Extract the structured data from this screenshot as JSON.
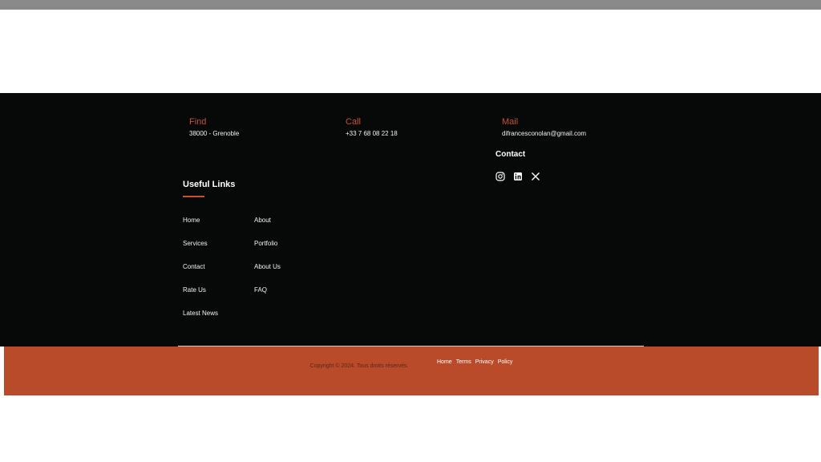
{
  "footer": {
    "find": {
      "title": "Find",
      "text": "38000 - Grenoble"
    },
    "call": {
      "title": "Call",
      "text": "+33 7 68 08 22 18"
    },
    "mail": {
      "title": "Mail",
      "text": "difrancesconolan@gmail.com"
    },
    "contact_heading": "Contact",
    "social": [
      "instagram-icon",
      "linkedin-icon",
      "x-icon"
    ],
    "useful_links_heading": "Useful Links",
    "links_left": [
      "Home",
      "Services",
      "Contact",
      "Rate Us",
      "Latest News"
    ],
    "links_right": [
      "About",
      "Portfolio",
      "About Us",
      "FAQ"
    ]
  },
  "bottom": {
    "copyright": "Copyright © 2024. Tous droits réservés.",
    "policy_links": [
      "Home",
      "Terms",
      "Privacy",
      "Policy"
    ]
  },
  "colors": {
    "accent": "#c8522e",
    "footer_bg": "#070808",
    "bottom_bar": "#b94b2b"
  }
}
